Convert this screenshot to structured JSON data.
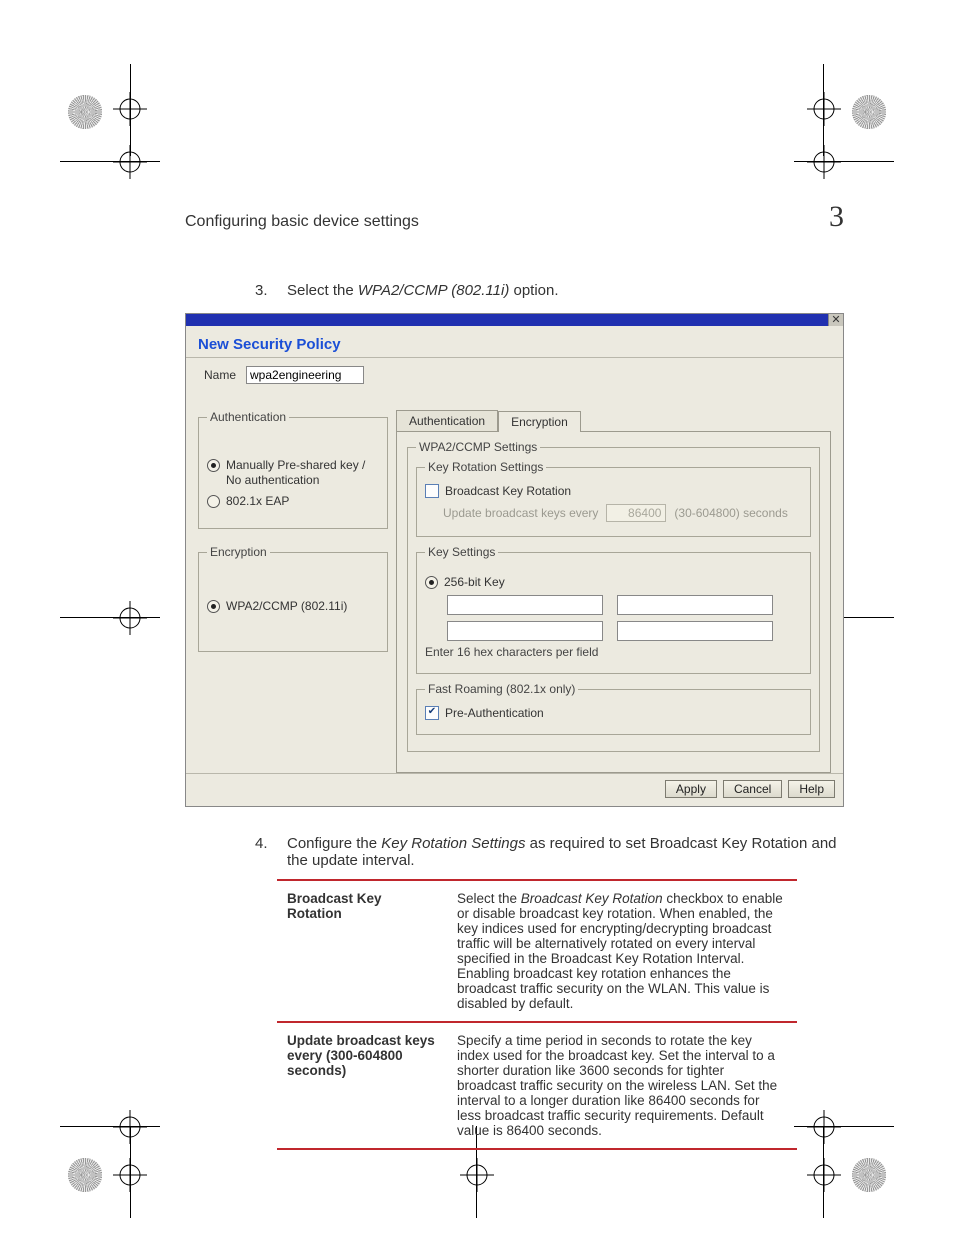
{
  "header": {
    "title": "Configuring basic device settings",
    "chapter_number": "3"
  },
  "step3": {
    "num": "3.",
    "pre": "Select the ",
    "italic": "WPA2/CCMP (802.11i)",
    "post": " option."
  },
  "dialog": {
    "title": "New Security Policy",
    "close_glyph": "✕",
    "name_label": "Name",
    "name_value": "wpa2engineering",
    "auth_legend": "Authentication",
    "auth_opt1": "Manually Pre-shared key / No authentication",
    "auth_opt2": "802.1x EAP",
    "enc_legend": "Encryption",
    "enc_opt1": "WPA2/CCMP (802.11i)",
    "tab_auth": "Authentication",
    "tab_enc": "Encryption",
    "wpa_legend": "WPA2/CCMP Settings",
    "keyrot_legend": "Key Rotation Settings",
    "bkr_label": "Broadcast Key Rotation",
    "update_label": "Update broadcast keys every",
    "update_value": "86400",
    "update_range": "(30-604800) seconds",
    "keyset_legend": "Key Settings",
    "keyset_opt": "256-bit Key",
    "keyhint": "Enter 16 hex characters per field",
    "roam_legend": "Fast Roaming (802.1x only)",
    "preauth_label": "Pre-Authentication",
    "btn_apply": "Apply",
    "btn_cancel": "Cancel",
    "btn_help": "Help"
  },
  "step4": {
    "num": "4.",
    "pre": "Configure the ",
    "italic": "Key Rotation Settings",
    "post": " as required to set Broadcast Key Rotation and the update interval."
  },
  "table": {
    "r1k": "Broadcast Key Rotation",
    "r1v_pre": "Select the ",
    "r1v_em": "Broadcast Key Rotation",
    "r1v_post": " checkbox to enable or disable broadcast key rotation. When enabled, the key indices used for encrypting/decrypting broadcast traffic will be alternatively rotated on every interval specified in the Broadcast Key Rotation Interval. Enabling broadcast key rotation enhances the broadcast traffic security on the WLAN. This value is disabled by default.",
    "r2k": "Update broadcast keys every (300-604800 seconds)",
    "r2v": "Specify a time period in seconds to rotate the key index used for the broadcast key. Set the interval to a shorter duration like 3600 seconds for tighter broadcast traffic security on the wireless LAN. Set the interval to a longer duration like 86400 seconds for less broadcast traffic security requirements. Default value is 86400 seconds."
  }
}
